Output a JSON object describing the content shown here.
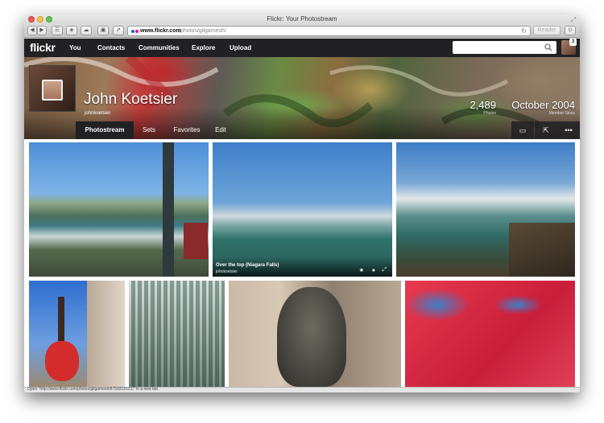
{
  "browser": {
    "window_title": "Flickr: Your Photostream",
    "url_host": "www.flickr.com",
    "url_path": "/photos/gilgamesh/",
    "reader_label": "Reader",
    "status_text": "Open \"http://www.flickr.com/photos/gilgamesh/8759315121/\" in a new tab"
  },
  "navbar": {
    "logo": "flickr",
    "items": [
      "You",
      "Contacts",
      "Communities",
      "Explore",
      "Upload"
    ],
    "notification_count": "3"
  },
  "profile": {
    "name": "John Koetsier",
    "username": "johnkoetsier",
    "photos_count": "2,489",
    "photos_label": "Photos",
    "member_since": "October 2004",
    "member_since_label": "Member Since"
  },
  "subnav": {
    "tabs": [
      "Photostream",
      "Sets",
      "Favorites",
      "Edit"
    ],
    "active_tab": "Photostream",
    "right_icons": [
      "slideshow-icon",
      "share-icon",
      "more-icon"
    ]
  },
  "photos": {
    "featured_title": "Over the top (Niagara Falls)",
    "featured_author": "johnkoetsier"
  },
  "colors": {
    "navbar_bg": "#212124",
    "logo_blue": "#0063dc",
    "logo_pink": "#ff0084"
  }
}
